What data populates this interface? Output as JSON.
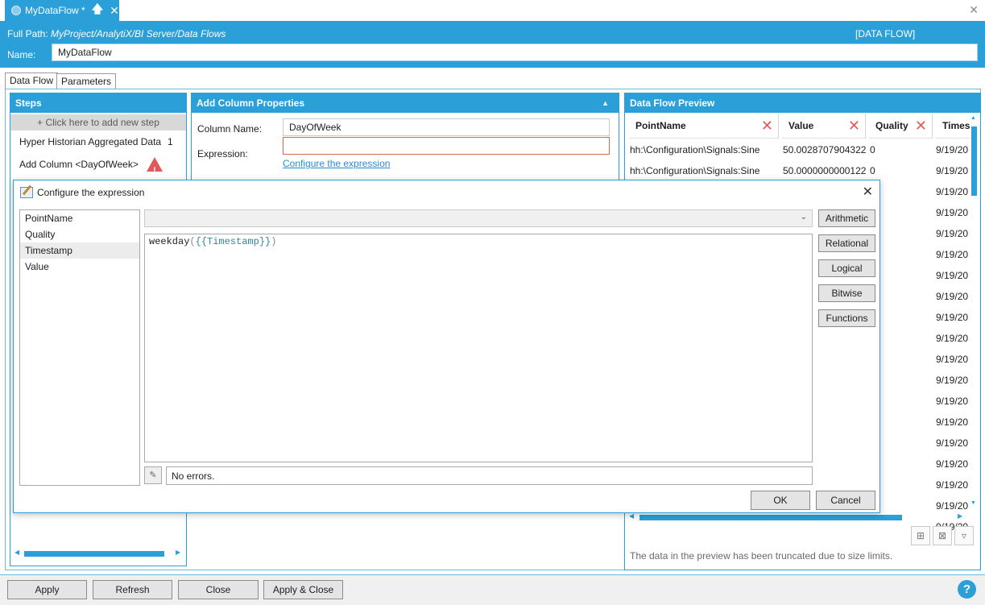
{
  "tab": {
    "title": "MyDataFlow *"
  },
  "header": {
    "fullpath_label": "Full Path:",
    "fullpath_value": "MyProject/AnalytiX/BI Server/Data Flows",
    "type_label": "[DATA FLOW]",
    "name_label": "Name:",
    "name_value": "MyDataFlow"
  },
  "inner_tabs": [
    "Data Flow",
    "Parameters"
  ],
  "steps": {
    "title": "Steps",
    "add_step": "+ Click here to add new step",
    "items": [
      {
        "label": "Hyper Historian Aggregated Data",
        "count": "1"
      },
      {
        "label": "Add Column <DayOfWeek>"
      }
    ]
  },
  "properties": {
    "title": "Add Column Properties",
    "column_name_label": "Column Name:",
    "column_name_value": "DayOfWeek",
    "expression_label": "Expression:",
    "expression_value": "",
    "configure_link": "Configure the expression"
  },
  "preview": {
    "title": "Data Flow Preview",
    "columns": [
      "PointName",
      "Value",
      "Quality",
      "Times"
    ],
    "rows": [
      {
        "point": "hh:\\Configuration\\Signals:Sine",
        "value": "50.0028707904322",
        "quality": "0",
        "time": "9/19/20"
      },
      {
        "point": "hh:\\Configuration\\Signals:Sine",
        "value": "50.0000000000122",
        "quality": "0",
        "time": "9/19/20"
      }
    ],
    "extra_times": [
      "9/19/20",
      "9/19/20",
      "9/19/20",
      "9/19/20",
      "9/19/20",
      "9/19/20",
      "9/19/20",
      "9/19/20",
      "9/19/20",
      "9/19/20",
      "9/19/20",
      "9/19/20",
      "9/19/20",
      "9/19/20",
      "9/19/20",
      "9/19/20",
      "9/19/20"
    ],
    "truncated_note": "The data in the preview has been truncated due to size limits."
  },
  "dialog": {
    "title": "Configure the expression",
    "fields": [
      "PointName",
      "Quality",
      "Timestamp",
      "Value"
    ],
    "selected_field": "Timestamp",
    "expression_fn": "weekday",
    "expression_open": "(",
    "expression_arg": "{{Timestamp}}",
    "expression_close": ")",
    "operators": [
      "Arithmetic",
      "Relational",
      "Logical",
      "Bitwise",
      "Functions"
    ],
    "status": "No errors.",
    "ok_label": "OK",
    "cancel_label": "Cancel"
  },
  "bottom": {
    "apply": "Apply",
    "refresh": "Refresh",
    "close": "Close",
    "apply_close": "Apply & Close",
    "help": "?"
  },
  "colors": {
    "accent": "#2a9fd8",
    "error": "#e05a5a"
  }
}
